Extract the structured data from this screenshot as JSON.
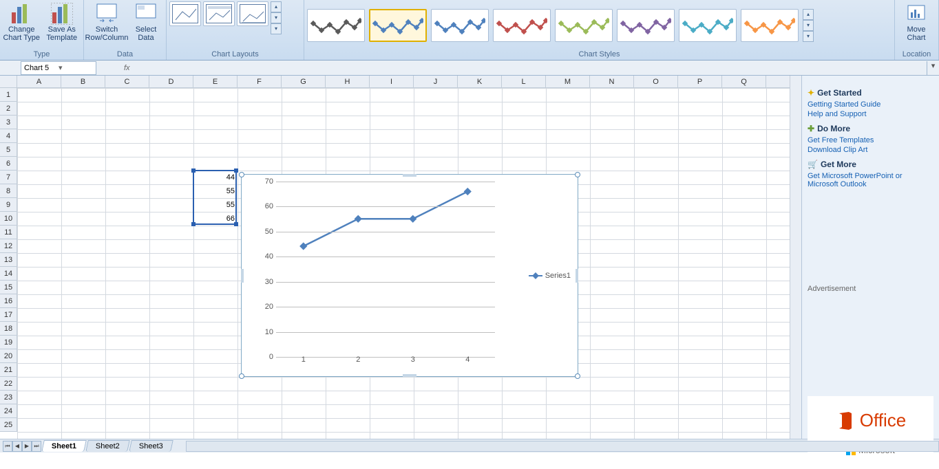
{
  "ribbon": {
    "type_group": {
      "label": "Type",
      "change": "Change\nChart Type",
      "saveas": "Save As\nTemplate"
    },
    "data_group": {
      "label": "Data",
      "switch": "Switch\nRow/Column",
      "select": "Select\nData"
    },
    "layouts_group": {
      "label": "Chart Layouts"
    },
    "styles_group": {
      "label": "Chart Styles"
    },
    "location_group": {
      "label": "Location",
      "move": "Move\nChart"
    }
  },
  "namebox": "Chart 5",
  "columns": [
    "A",
    "B",
    "C",
    "D",
    "E",
    "F",
    "G",
    "H",
    "I",
    "J",
    "K",
    "L",
    "M",
    "N",
    "O",
    "P",
    "Q"
  ],
  "rows_visible": 25,
  "data_cells": [
    {
      "col": 5,
      "row": 7,
      "val": "44"
    },
    {
      "col": 5,
      "row": 8,
      "val": "55"
    },
    {
      "col": 5,
      "row": 9,
      "val": "55"
    },
    {
      "col": 5,
      "row": 10,
      "val": "66"
    }
  ],
  "chart_data": {
    "type": "line",
    "categories": [
      "1",
      "2",
      "3",
      "4"
    ],
    "series": [
      {
        "name": "Series1",
        "values": [
          44,
          55,
          55,
          66
        ]
      }
    ],
    "yticks": [
      0,
      10,
      20,
      30,
      40,
      50,
      60,
      70
    ],
    "ylim": [
      0,
      70
    ]
  },
  "sheets": [
    "Sheet1",
    "Sheet2",
    "Sheet3"
  ],
  "active_sheet": 0,
  "side": {
    "get_started": "Get Started",
    "gs_links": [
      "Getting Started Guide",
      "Help and Support"
    ],
    "do_more": "Do More",
    "dm_links": [
      "Get Free Templates",
      "Download Clip Art"
    ],
    "get_more": "Get More",
    "gm_links": [
      "Get Microsoft PowerPoint or Microsoft Outlook"
    ],
    "ad_label": "Advertisement",
    "office": "Office",
    "ms": "Microsoft"
  },
  "style_colors": [
    "#5a5a5a",
    "#4f81bd",
    "#4f81bd",
    "#c0504d",
    "#9bbb59",
    "#8064a2",
    "#4bacc6",
    "#f79646"
  ]
}
